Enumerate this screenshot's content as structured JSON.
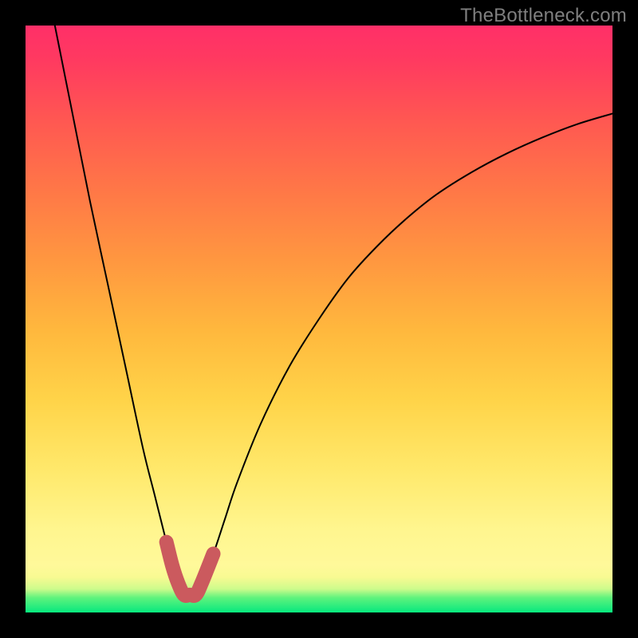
{
  "watermark": "TheBottleneck.com",
  "chart_data": {
    "type": "line",
    "title": "",
    "xlabel": "",
    "ylabel": "",
    "xlim": [
      0,
      100
    ],
    "ylim": [
      0,
      100
    ],
    "grid": false,
    "series": [
      {
        "name": "curve",
        "x": [
          5,
          8,
          11,
          14,
          17,
          20,
          22,
          24,
          25,
          26,
          27,
          28,
          29,
          30,
          32,
          34,
          36,
          40,
          45,
          50,
          55,
          60,
          65,
          70,
          76,
          82,
          88,
          94,
          100
        ],
        "y": [
          100,
          85,
          70,
          56,
          42,
          28,
          20,
          12,
          8,
          5,
          3,
          3,
          3,
          5,
          10,
          16,
          22,
          32,
          42,
          50,
          57,
          62.5,
          67.2,
          71.2,
          75,
          78.2,
          80.9,
          83.2,
          85
        ]
      }
    ],
    "highlight": {
      "name": "bottom-accent",
      "x_range": [
        23,
        32
      ],
      "y_range": [
        3,
        16
      ]
    },
    "background_gradient": [
      "#07e87e",
      "#fff68f",
      "#ff9740",
      "#ff2f68"
    ]
  }
}
